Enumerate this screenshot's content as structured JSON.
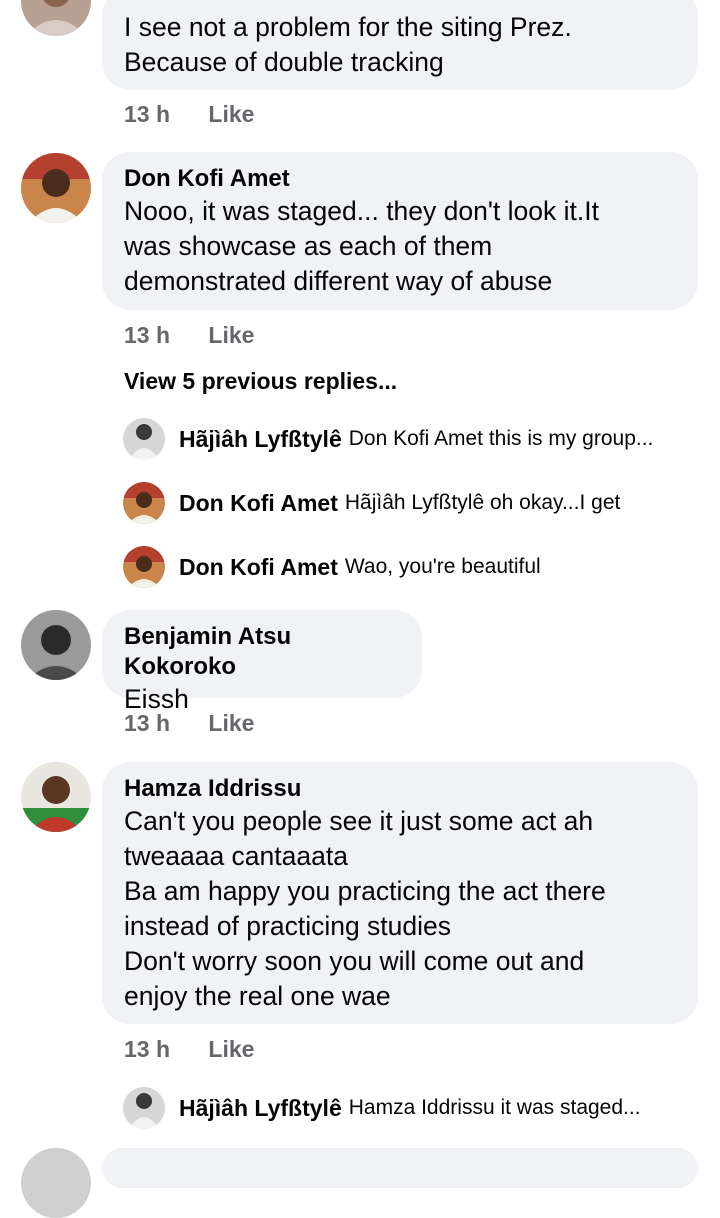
{
  "comments": [
    {
      "author": "",
      "text": "I see not a problem for the siting  Prez.\nBecause  of double  tracking",
      "time": "13 h",
      "like": "Like"
    },
    {
      "author": "Don Kofi Amet",
      "text": "Nooo, it was staged... they don't look it.It\nwas showcase as each of them\ndemonstrated different way of abuse",
      "time": "13 h",
      "like": "Like",
      "view_previous": "View 5 previous replies..."
    },
    {
      "author": "Benjamin Atsu Kokoroko",
      "text": "Eissh",
      "time": "13 h",
      "like": "Like"
    },
    {
      "author": "Hamza Iddrissu",
      "text": "Can't you people see it just some act ah\ntweaaaa cantaaata\nBa am happy you practicing the act there\ninstead of practicing studies\nDon't worry soon you will come out and\nenjoy the real one wae",
      "time": "13 h",
      "like": "Like"
    }
  ],
  "replies": [
    {
      "author": "Hãjìâh Lyfßtylê",
      "text": "Don Kofi Amet this is my group..."
    },
    {
      "author": "Don Kofi Amet",
      "text": "Hãjìâh Lyfßtylê oh okay...I get"
    },
    {
      "author": "Don Kofi Amet",
      "text": "Wao, you're beautiful"
    },
    {
      "author": "Hãjìâh Lyfßtylê",
      "text": "Hamza Iddrissu it was staged..."
    }
  ],
  "colors": {
    "bubble": "#f0f2f5",
    "secondary_text": "#65676b"
  }
}
